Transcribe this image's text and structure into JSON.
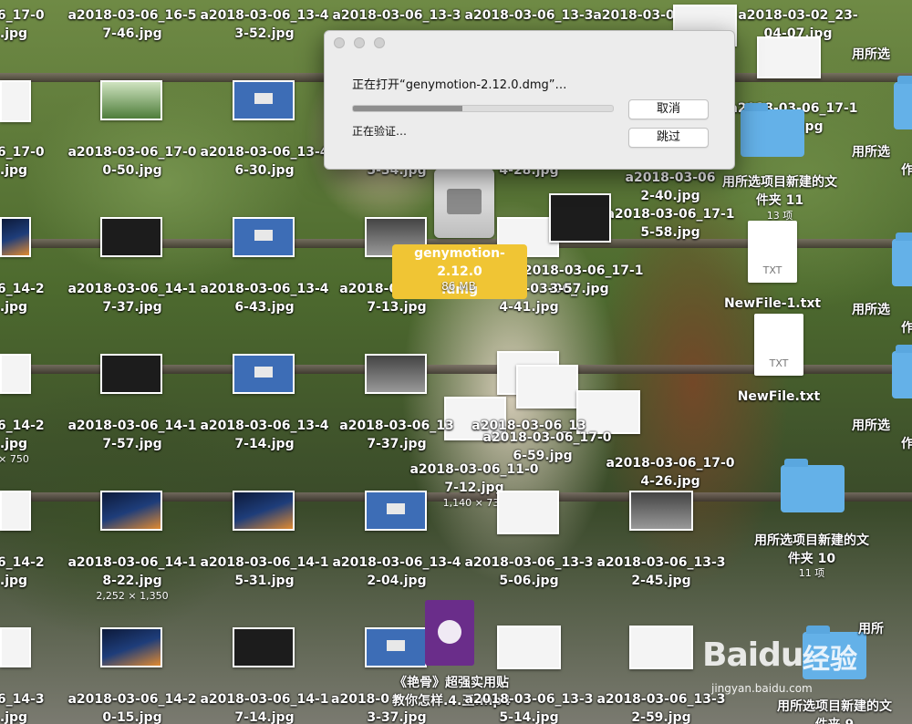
{
  "dialog": {
    "title": "正在打开“genymotion-2.12.0.dmg”…",
    "status": "正在验证…",
    "progress_fraction": 0.42,
    "cancel_label": "取消",
    "skip_label": "跳过"
  },
  "selected_file": {
    "name_line1": "genymotion-2.12.0",
    "name_line2": ".dmg",
    "size": "86 MB"
  },
  "labels": {
    "r0c0": "-06_17-0",
    "r0c0b": ".jpg",
    "r0c1": "a2018-03-06_16-5",
    "r0c1b": "7-46.jpg",
    "r0c2": "a2018-03-06_13-4",
    "r0c2b": "3-52.jpg",
    "r0c3": "a2018-03-06_13-3",
    "r0c4": "a2018-03-06_13-3",
    "r0c5": "a2018-03-0",
    "r0c6": "a2018-03-02_23-",
    "r0c6b": "04-07.jpg",
    "r1c0": "-06_17-0",
    "r1c0b": ".jpg",
    "r1c1": "a2018-03-06_17-0",
    "r1c1b": "0-50.jpg",
    "r1c2": "a2018-03-06_13-4",
    "r1c2b": "6-30.jpg",
    "r1c3b": "5-34.jpg",
    "r1c4b": "4-28.jpg",
    "r1c5": "a2018-03-06",
    "r1c5b": "2-40.jpg",
    "r1c6": "a2018-03-06_17-1",
    "r1c6b": "6-29.jpg",
    "r1c7": "a2018-03-06_17-1",
    "r1c7b": "5-58.jpg",
    "r2c0": "-06_14-2",
    "r2c0b": ".jpg",
    "r2c1": "a2018-03-06_14-1",
    "r2c1b": "7-37.jpg",
    "r2c2": "a2018-03-06_13-4",
    "r2c2b": "6-43.jpg",
    "r2c3": "a2018-03-06_13",
    "r2c3b": "7-13.jpg",
    "r2c4": "a2018-03-06_",
    "r2c4b": "4-41.jpg",
    "r2c5": "a2018-03-06_17-1",
    "r2c5b": "3-57.jpg",
    "r3c0": "-06_14-2",
    "r3c0b": ".jpg",
    "r3c0s": "× 750",
    "r3c1": "a2018-03-06_14-1",
    "r3c1b": "7-57.jpg",
    "r3c2": "a2018-03-06_13-4",
    "r3c2b": "7-14.jpg",
    "r3c3": "a2018-03-06_13",
    "r3c3b": "7-37.jpg",
    "r3c4": "a2018-03-06_13",
    "r3c4b": "6-59.jpg",
    "r3c5": "a2018-03-06_17-0",
    "r3c6": "a2018-03-06_11-0",
    "r3c6b": "7-12.jpg",
    "r3c6s": "1,140 × 732",
    "r3c7": "a2018-03-06_17-0",
    "r3c7b": "4-26.jpg",
    "r4c0": "-06_14-2",
    "r4c0b": ".jpg",
    "r4c1": "a2018-03-06_14-1",
    "r4c1b": "8-22.jpg",
    "r4c1s": "2,252 × 1,350",
    "r4c2": "a2018-03-06_14-1",
    "r4c2b": "5-31.jpg",
    "r4c3": "a2018-03-06_13-4",
    "r4c3b": "2-04.jpg",
    "r4c4": "a2018-03-06_13-3",
    "r4c4b": "5-06.jpg",
    "r4c5": "a2018-03-06_13-3",
    "r4c5b": "2-45.jpg",
    "r5c0": "-06_14-3",
    "r5c0b": ".jpg",
    "r5c1": "a2018-03-06_14-2",
    "r5c1b": "0-15.jpg",
    "r5c2": "a2018-03-06_14-1",
    "r5c2b": "7-14.jpg",
    "r5c3": "a2018-0",
    "r5c3b": "3-37.jpg",
    "r5c4": "a2018-03-06_13-3",
    "r5c4b": "5-14.jpg",
    "r5c5": "a2018-03-06_13-3",
    "r5c5b": "2-59.jpg"
  },
  "movie": {
    "line1": "《艳骨》超强实用贴",
    "line2": "教你怎样.4.王.mp4"
  },
  "files": {
    "txt1": "NewFile-1.txt",
    "txt2": "NewFile.txt",
    "txt_tag": "TXT"
  },
  "folders": {
    "f11_name": "用所选项目新建的文",
    "f11_name2": "件夹 11",
    "f11_count": "13 项",
    "f10_name": "用所选项目新建的文",
    "f10_name2": "件夹 10",
    "f10_count": "11 项",
    "f9_name": "用所选项目新建的文",
    "f9_name2": "件夹 9",
    "edge1": "用所选",
    "edge1b": "作",
    "edge2": "用所选",
    "edge2b": "作",
    "edge3": "用所选",
    "edge3b": "作",
    "edge4": "用所选",
    "edge4b": "作",
    "edge5": "用所"
  },
  "watermark": {
    "brand": "Baidu",
    "jingyan": "经验",
    "url": "jingyan.baidu.com"
  }
}
